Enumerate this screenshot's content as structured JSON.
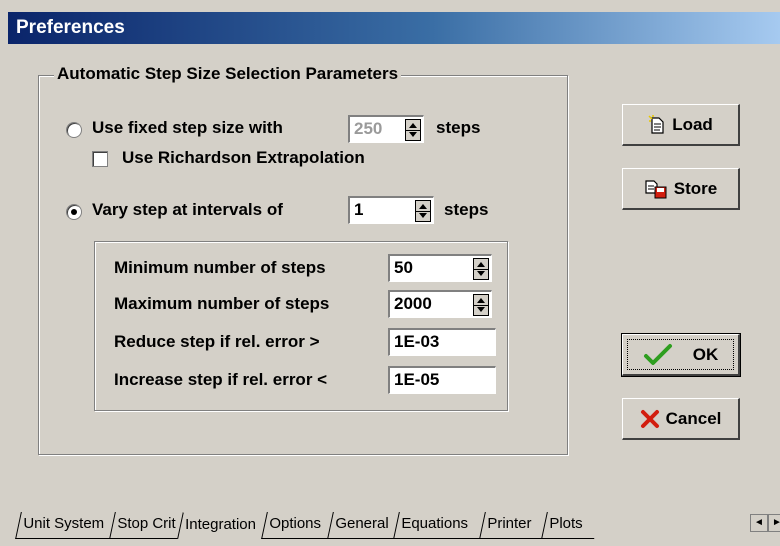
{
  "window": {
    "title": "Preferences"
  },
  "group": {
    "title": "Automatic Step Size Selection Parameters",
    "fixed_option": {
      "label": "Use fixed step size with",
      "value": "250",
      "suffix": "steps",
      "selected": false
    },
    "richardson": {
      "label": "Use Richardson Extrapolation",
      "checked": false
    },
    "vary_option": {
      "label": "Vary step at intervals of",
      "value": "1",
      "suffix": "steps",
      "selected": true
    },
    "params": {
      "min_steps": {
        "label": "Minimum number of steps",
        "value": "50"
      },
      "max_steps": {
        "label": "Maximum number of steps",
        "value": "2000"
      },
      "reduce": {
        "label": "Reduce step if rel. error >",
        "value": "1E-03"
      },
      "increase": {
        "label": "Increase step if rel. error <",
        "value": "1E-05"
      }
    }
  },
  "buttons": {
    "load": "Load",
    "store": "Store",
    "ok": "OK",
    "cancel": "Cancel"
  },
  "tabs": [
    "Unit System",
    "Stop Crit",
    "Integration",
    "Options",
    "General",
    "Equations",
    "Printer",
    "Plots"
  ],
  "active_tab": "Integration",
  "icons": {
    "load": "document-open-icon",
    "store": "save-icon",
    "ok": "checkmark-icon",
    "cancel": "red-x-icon",
    "tab_scroll_left": "arrow-left-icon",
    "tab_scroll_right": "arrow-right-icon"
  },
  "colors": {
    "titlebar_start": "#0a246a",
    "titlebar_end": "#a6caf0",
    "dialog_bg": "#d4d0c8",
    "ok_check": "#2e9e1f",
    "cancel_x": "#d21e0f"
  }
}
